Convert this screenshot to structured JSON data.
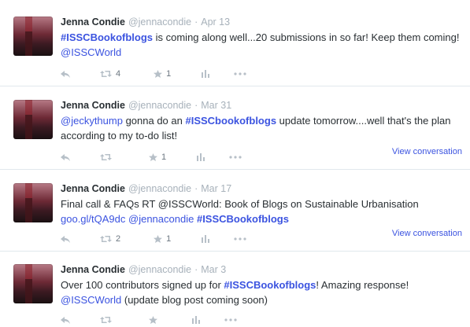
{
  "tweets": [
    {
      "name": "Jenna Condie",
      "handle": "@jennacondie",
      "date": "Apr 13",
      "segments": [
        {
          "t": "#ISSCBookofblogs",
          "k": "hashtag"
        },
        {
          "t": " is coming along well...20 submissions in so far! Keep them coming! ",
          "k": "text"
        },
        {
          "t": "@ISSCWorld",
          "k": "link"
        }
      ],
      "retweets": "4",
      "favorites": "1",
      "view_conversation": ""
    },
    {
      "name": "Jenna Condie",
      "handle": "@jennacondie",
      "date": "Mar 31",
      "segments": [
        {
          "t": "@jeckythump",
          "k": "link"
        },
        {
          "t": " gonna do an ",
          "k": "text"
        },
        {
          "t": "#ISSCbookofblogs",
          "k": "hashtag"
        },
        {
          "t": " update tomorrow....well that's the plan according to my to-do list!",
          "k": "text"
        }
      ],
      "retweets": "",
      "favorites": "1",
      "view_conversation": "View conversation"
    },
    {
      "name": "Jenna Condie",
      "handle": "@jennacondie",
      "date": "Mar 17",
      "segments": [
        {
          "t": "Final call & FAQs RT @ISSCWorld: Book of Blogs on Sustainable Urbanisation ",
          "k": "text"
        },
        {
          "t": "goo.gl/tQA9dc",
          "k": "link"
        },
        {
          "t": " ",
          "k": "text"
        },
        {
          "t": "@jennacondie",
          "k": "link"
        },
        {
          "t": " ",
          "k": "text"
        },
        {
          "t": "#ISSCBookofblogs",
          "k": "hashtag"
        }
      ],
      "retweets": "2",
      "favorites": "1",
      "view_conversation": "View conversation"
    },
    {
      "name": "Jenna Condie",
      "handle": "@jennacondie",
      "date": "Mar 3",
      "segments": [
        {
          "t": "Over 100 contributors signed up for ",
          "k": "text"
        },
        {
          "t": "#ISSCBookofblogs",
          "k": "hashtag"
        },
        {
          "t": "! Amazing response! ",
          "k": "text"
        },
        {
          "t": "@ISSCWorld",
          "k": "link"
        },
        {
          "t": " (update blog post coming soon)",
          "k": "text"
        }
      ],
      "retweets": "",
      "favorites": "",
      "view_conversation": ""
    }
  ]
}
